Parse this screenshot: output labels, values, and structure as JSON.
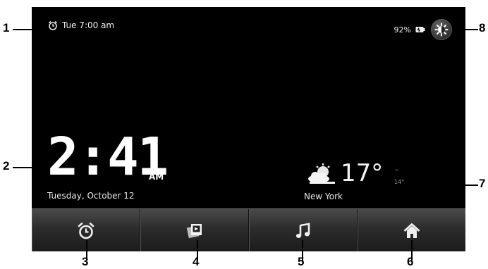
{
  "status_bar": {
    "alarm_text": "Tue 7:00 am",
    "battery_percent": "92%"
  },
  "clock": {
    "time": "2:41",
    "ampm": "AM",
    "date": "Tuesday, October 12"
  },
  "weather": {
    "temperature": "17°",
    "high": "–",
    "low": "14°",
    "city": "New York"
  },
  "dock": {
    "items": [
      {
        "name": "alarm",
        "icon": "alarm-clock-icon"
      },
      {
        "name": "gallery",
        "icon": "photo-gallery-icon"
      },
      {
        "name": "music",
        "icon": "music-note-icon"
      },
      {
        "name": "home",
        "icon": "home-icon"
      }
    ]
  },
  "callouts": [
    "1",
    "2",
    "3",
    "4",
    "5",
    "6",
    "7",
    "8"
  ],
  "colors": {
    "screen_bg": "#000000",
    "text": "#ffffff",
    "dock_top": "#4a4a4a",
    "dock_bottom": "#1b1b1b"
  }
}
